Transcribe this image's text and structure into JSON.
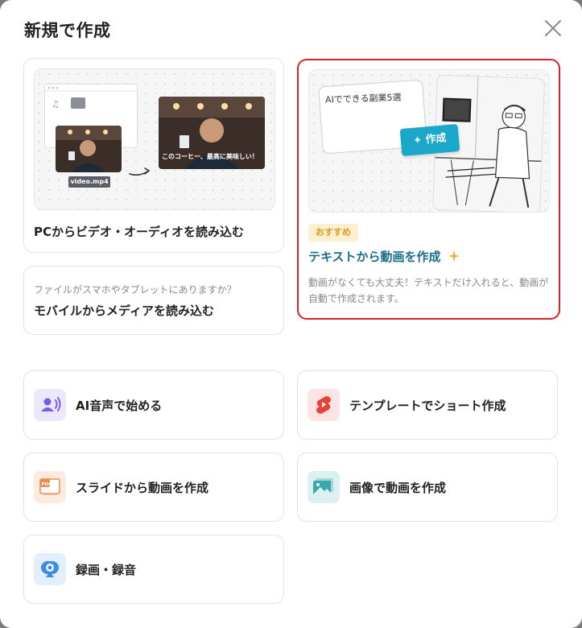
{
  "dialog": {
    "title": "新規で作成"
  },
  "import_pc": {
    "label": "PCからビデオ・オーディオを読み込む",
    "file_tag": "video.mp4",
    "photo_caption": "このコーヒー、最高に美味しい！"
  },
  "import_mobile": {
    "sub": "ファイルがスマホやタブレットにありますか？",
    "label": "モバイルからメディアを読み込む"
  },
  "text_to_video": {
    "badge": "おすすめ",
    "title": "テキストから動画を作成",
    "description": "動画がなくても大丈夫！テキストだけ入れると、動画が自動で作成されます。",
    "note_text": "AIでできる副業5選",
    "create_chip": "作成",
    "sparkle_color": "#f5a623"
  },
  "options": {
    "ai_voice": {
      "label": "AI音声で始める",
      "icon_bg": "#ece8fb",
      "icon_color": "#7b5ce8"
    },
    "template_short": {
      "label": "テンプレートでショート作成",
      "icon_bg": "#fde3e3",
      "icon_color": "#e8413d"
    },
    "slide_video": {
      "label": "スライドから動画を作成",
      "icon_bg": "#fdebe0",
      "icon_color": "#f08a4b"
    },
    "image_video": {
      "label": "画像で動画を作成",
      "icon_bg": "#dcf0f1",
      "icon_color": "#3aa7a8"
    },
    "record": {
      "label": "録画・録音",
      "icon_bg": "#e2efff",
      "icon_color": "#3c8be8"
    }
  },
  "colors": {
    "accent": "#196d8a",
    "highlight_border": "#d8232a"
  }
}
